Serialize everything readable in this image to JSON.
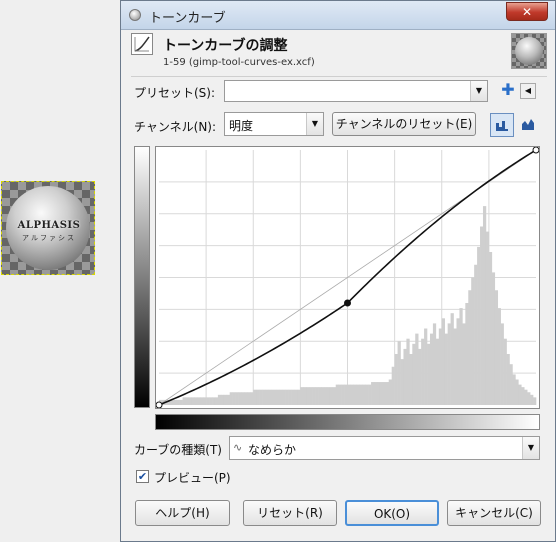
{
  "image_thumb": {
    "logo_text": "ALPHASIS",
    "logo_sub": "アルファシス"
  },
  "window": {
    "title": "トーンカーブ",
    "close": "✕"
  },
  "header": {
    "title": "トーンカーブの調整",
    "subtitle": "1-59 (gimp-tool-curves-ex.xcf)"
  },
  "presets": {
    "label": "プリセット(S):",
    "value": ""
  },
  "channel": {
    "label": "チャンネル(N):",
    "value": "明度",
    "reset_label": "チャンネルのリセット(E)"
  },
  "curve": {
    "control_points": [
      [
        0,
        0
      ],
      [
        0.5,
        0.4
      ],
      [
        1,
        1
      ]
    ],
    "histogram": {
      "peak_input": 0.87,
      "bins": [
        0.02,
        0.02,
        0.02,
        0.02,
        0.02,
        0.02,
        0.02,
        0.02,
        0.03,
        0.03,
        0.03,
        0.03,
        0.03,
        0.03,
        0.03,
        0.03,
        0.03,
        0.03,
        0.03,
        0.03,
        0.04,
        0.04,
        0.04,
        0.04,
        0.05,
        0.05,
        0.05,
        0.05,
        0.05,
        0.05,
        0.05,
        0.05,
        0.06,
        0.06,
        0.06,
        0.06,
        0.06,
        0.06,
        0.06,
        0.06,
        0.06,
        0.06,
        0.06,
        0.06,
        0.06,
        0.06,
        0.06,
        0.06,
        0.07,
        0.07,
        0.07,
        0.07,
        0.07,
        0.07,
        0.07,
        0.07,
        0.07,
        0.07,
        0.07,
        0.07,
        0.08,
        0.08,
        0.08,
        0.08,
        0.08,
        0.08,
        0.08,
        0.08,
        0.08,
        0.08,
        0.08,
        0.08,
        0.09,
        0.09,
        0.09,
        0.09,
        0.09,
        0.09,
        0.1,
        0.15,
        0.2,
        0.25,
        0.18,
        0.22,
        0.26,
        0.2,
        0.24,
        0.28,
        0.22,
        0.26,
        0.3,
        0.24,
        0.28,
        0.32,
        0.26,
        0.3,
        0.34,
        0.28,
        0.32,
        0.36,
        0.3,
        0.34,
        0.38,
        0.32,
        0.4,
        0.45,
        0.5,
        0.55,
        0.62,
        0.7,
        0.78,
        0.68,
        0.6,
        0.52,
        0.45,
        0.38,
        0.32,
        0.26,
        0.2,
        0.16,
        0.12,
        0.1,
        0.08,
        0.07,
        0.06,
        0.05,
        0.04,
        0.03
      ]
    }
  },
  "curve_type": {
    "label": "カーブの種類(T)",
    "value": "なめらか"
  },
  "preview": {
    "label": "プレビュー(P)",
    "checked": true
  },
  "buttons": {
    "help": "ヘルプ(H)",
    "reset": "リセット(R)",
    "ok": "OK(O)",
    "cancel": "キャンセル(C)"
  }
}
